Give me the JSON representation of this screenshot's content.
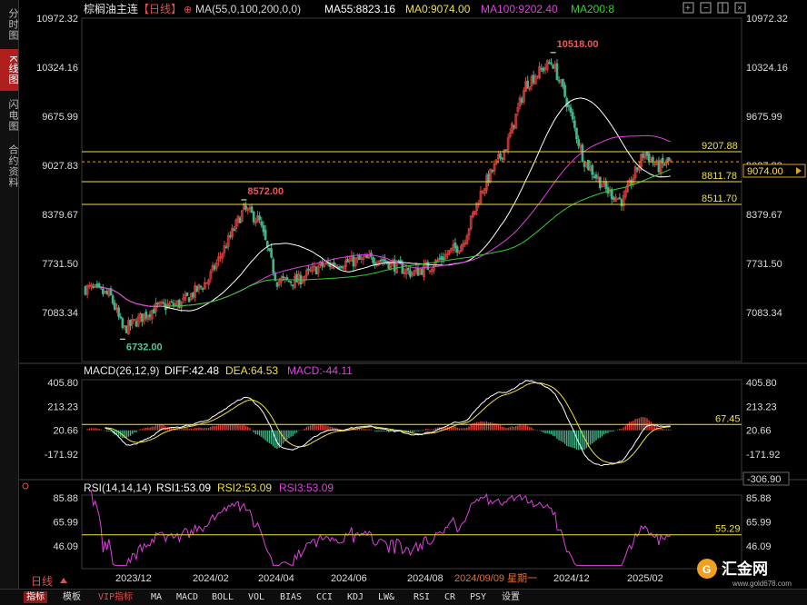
{
  "sidebar": {
    "tabs": [
      {
        "label": "分时图",
        "active": false
      },
      {
        "label": "K线图",
        "active": true
      },
      {
        "label": "闪电图",
        "active": false
      },
      {
        "label": "合约资料",
        "active": false
      }
    ]
  },
  "header": {
    "instrument": "棕榈油主连",
    "period": "【日线】",
    "ma_params": "MA(55,0,100,200,0,0)",
    "ma55": "MA55:8823.16",
    "ma0": "MA0:9074.00",
    "ma100": "MA100:9202.40",
    "ma200": "MA200:8"
  },
  "main_chart": {
    "left_ticks": [
      "10972.32",
      "10324.16",
      "9675.99",
      "9027.83",
      "8379.67",
      "7731.50",
      "7083.34"
    ],
    "right_ticks": [
      "10972.32",
      "10324.16",
      "9675.99",
      "9027.83",
      "8379.67",
      "7731.50",
      "7083.34"
    ],
    "current_price": "9074.00",
    "high_label": "10518.00",
    "low_label": "6732.00",
    "local_high_label": "8572.00",
    "level_lines": [
      "9207.88",
      "8811.78",
      "8511.70"
    ]
  },
  "macd": {
    "title": "MACD(26,12,9)",
    "diff": "DIFF:42.48",
    "dea": "DEA:64.53",
    "macd": "MACD:-44.11",
    "ticks": [
      "405.80",
      "213.23",
      "20.66",
      "-171.92"
    ],
    "right_ticks": [
      "405.80",
      "213.23",
      "20.66",
      "-171.92"
    ],
    "level": "67.45",
    "min_label": "-306.90"
  },
  "rsi": {
    "title": "RSI(14,14,14)",
    "rsi1": "RSI1:53.09",
    "rsi2": "RSI2:53.09",
    "rsi3": "RSI3:53.09",
    "ticks": [
      "85.88",
      "65.99",
      "46.09"
    ],
    "right_ticks": [
      "85.88",
      "65.99",
      "46.09"
    ],
    "level": "55.29"
  },
  "x_axis": {
    "labels": [
      "2023/12",
      "2024/02",
      "2024/04",
      "2024/06",
      "2024/08",
      "2024/12",
      "2025/02"
    ],
    "cursor_date": "2024/09/09 星期一"
  },
  "period_label": "日线",
  "watermark": "汇金网",
  "watermark_url": "www.gold678.com",
  "bottom_tabs": [
    "指标",
    "模板",
    "VIP指标",
    "MA",
    "MACD",
    "BOLL",
    "VOL",
    "BIAS",
    "CCI",
    "KDJ",
    "LW&",
    "RSI",
    "CR",
    "PSY",
    "设置"
  ],
  "colors": {
    "up": "#e0403c",
    "down": "#3fb58a",
    "ma55": "#ffffff",
    "ma100": "#e040e0",
    "ma200": "#30d030",
    "level": "#f0e040",
    "label_high": "#ff5050",
    "label_low": "#50c8a0"
  },
  "chart_data": {
    "type": "candlestick",
    "title": "棕榈油主连【日线】",
    "x_range": [
      "2023/11",
      "2025/03"
    ],
    "ylim": [
      6732,
      10972.32
    ],
    "anchors": [
      {
        "date": "2023/11/20",
        "close": 7400
      },
      {
        "date": "2023/12/05",
        "close": 7300
      },
      {
        "date": "2023/12/15",
        "close": 6850
      },
      {
        "date": "2024/01/10",
        "close": 7150
      },
      {
        "date": "2024/01/30",
        "close": 7200
      },
      {
        "date": "2024/02/20",
        "close": 7500
      },
      {
        "date": "2024/03/05",
        "close": 7950
      },
      {
        "date": "2024/03/20",
        "close": 8450
      },
      {
        "date": "2024/04/01",
        "close": 8300
      },
      {
        "date": "2024/04/15",
        "close": 7500
      },
      {
        "date": "2024/05/01",
        "close": 7500
      },
      {
        "date": "2024/05/20",
        "close": 7700
      },
      {
        "date": "2024/06/10",
        "close": 7750
      },
      {
        "date": "2024/07/05",
        "close": 7800
      },
      {
        "date": "2024/08/01",
        "close": 7600
      },
      {
        "date": "2024/08/15",
        "close": 7700
      },
      {
        "date": "2024/09/10",
        "close": 8000
      },
      {
        "date": "2024/09/25",
        "close": 8700
      },
      {
        "date": "2024/10/15",
        "close": 9300
      },
      {
        "date": "2024/10/30",
        "close": 10100
      },
      {
        "date": "2024/11/12",
        "close": 10300
      },
      {
        "date": "2024/11/20",
        "close": 10400
      },
      {
        "date": "2024/12/01",
        "close": 9900
      },
      {
        "date": "2024/12/15",
        "close": 9100
      },
      {
        "date": "2025/01/02",
        "close": 8700
      },
      {
        "date": "2025/01/15",
        "close": 8550
      },
      {
        "date": "2025/02/01",
        "close": 9200
      },
      {
        "date": "2025/02/12",
        "close": 9000
      },
      {
        "date": "2025/02/20",
        "close": 9074
      }
    ],
    "annotations": [
      {
        "label": "10518.00",
        "date": "2024/11/20",
        "value": 10518
      },
      {
        "label": "8572.00",
        "date": "2024/03/20",
        "value": 8572
      },
      {
        "label": "6732.00",
        "date": "2023/12/15",
        "value": 6732
      }
    ]
  }
}
